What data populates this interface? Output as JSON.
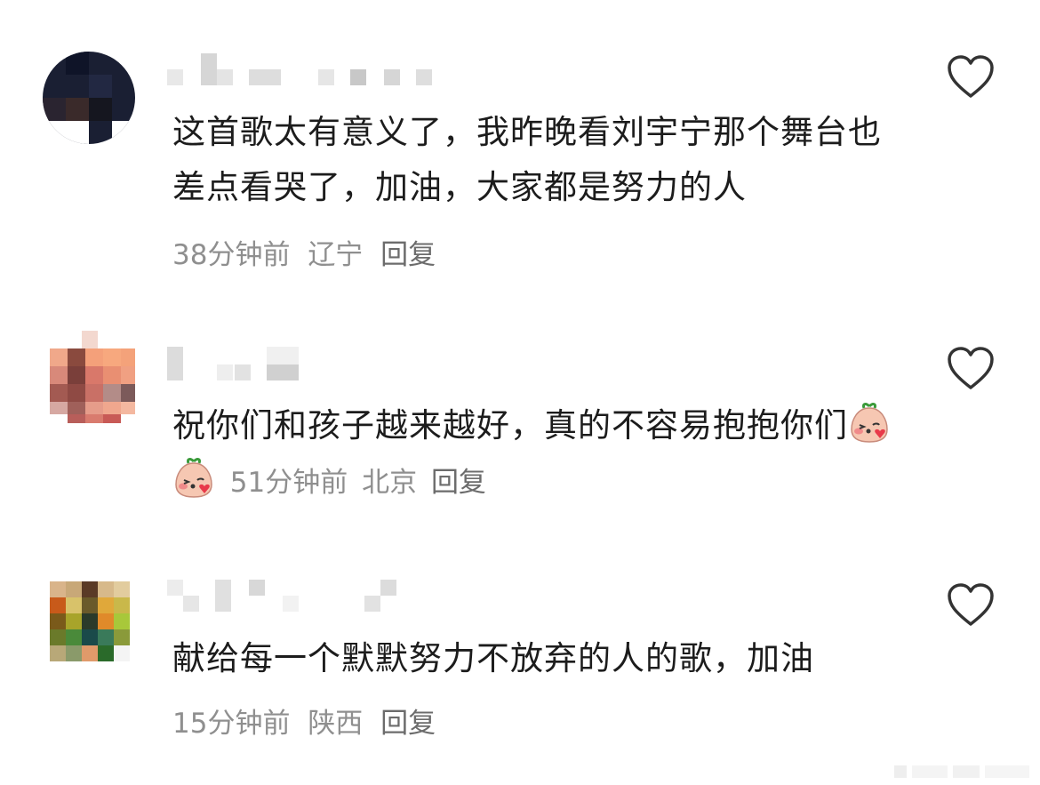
{
  "comments": [
    {
      "text": "这首歌太有意义了，我昨晚看刘宇宁那个舞台也差点看哭了，加油，大家都是努力的人",
      "time": "38分钟前",
      "location": "辽宁",
      "reply_label": "回复"
    },
    {
      "text": "祝你们和孩子越来越好，真的不容易抱抱你们",
      "emojis": [
        "blush-kiss-emoji",
        "blush-kiss-emoji"
      ],
      "time": "51分钟前",
      "location": "北京",
      "reply_label": "回复"
    },
    {
      "text": "献给每一个默默努力不放弃的人的歌，加油",
      "time": "15分钟前",
      "location": "陕西",
      "reply_label": "回复"
    }
  ],
  "icons": {
    "like": "heart-outline-icon"
  },
  "colors": {
    "text": "#1c1c1c",
    "meta": "#8f8f8f",
    "icon": "#333333"
  }
}
